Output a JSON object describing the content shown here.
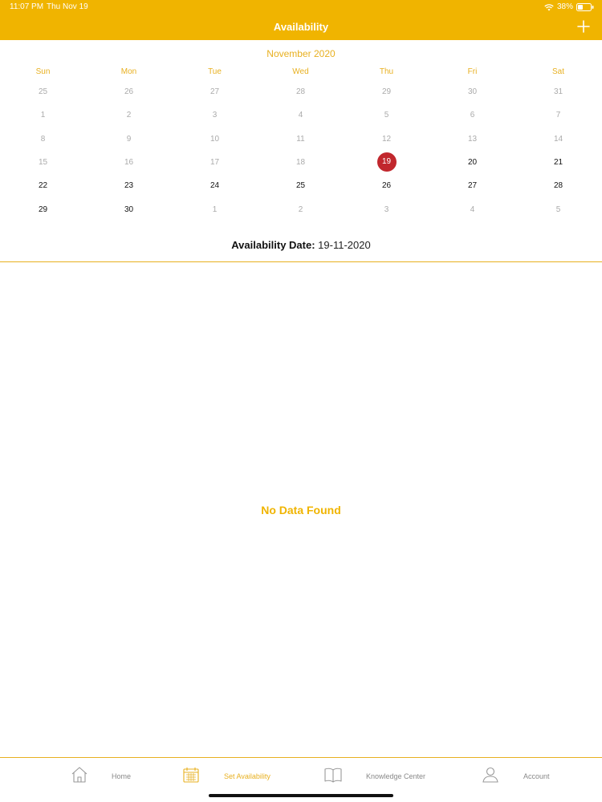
{
  "status": {
    "time": "11:07 PM",
    "date": "Thu Nov 19",
    "battery": "38%"
  },
  "header": {
    "title": "Availability",
    "add_icon": "plus-icon"
  },
  "calendar": {
    "month_title": "November 2020",
    "weekdays": [
      "Sun",
      "Mon",
      "Tue",
      "Wed",
      "Thu",
      "Fri",
      "Sat"
    ],
    "weeks": [
      [
        "25",
        "26",
        "27",
        "28",
        "29",
        "30",
        "31"
      ],
      [
        "1",
        "2",
        "3",
        "4",
        "5",
        "6",
        "7"
      ],
      [
        "8",
        "9",
        "10",
        "11",
        "12",
        "13",
        "14"
      ],
      [
        "15",
        "16",
        "17",
        "18",
        "19",
        "20",
        "21"
      ],
      [
        "22",
        "23",
        "24",
        "25",
        "26",
        "27",
        "28"
      ],
      [
        "29",
        "30",
        "1",
        "2",
        "3",
        "4",
        "5"
      ]
    ],
    "selected_day": "19",
    "accent_color": "#f0b400",
    "selected_color": "#c1272d"
  },
  "availability": {
    "label": "Availability Date:",
    "value": "19-11-2020"
  },
  "empty_state": {
    "message": "No Data Found"
  },
  "tabs": [
    {
      "label": "Home",
      "icon": "home-icon",
      "active": false
    },
    {
      "label": "Set Availability",
      "icon": "calendar-icon",
      "active": true
    },
    {
      "label": "Knowledge Center",
      "icon": "book-icon",
      "active": false
    },
    {
      "label": "Account",
      "icon": "user-icon",
      "active": false
    }
  ]
}
